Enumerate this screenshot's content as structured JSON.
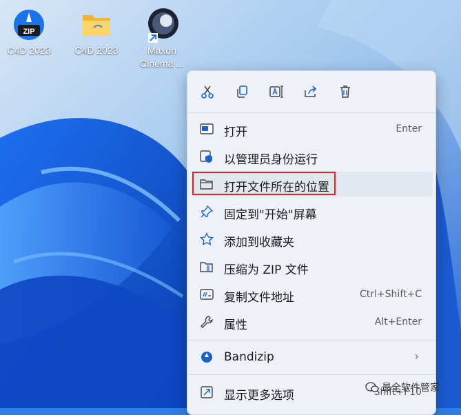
{
  "desktop": {
    "icons": [
      {
        "label": "C4D 2023",
        "icon": "bandizip-zip-icon"
      },
      {
        "label": "C4D 2023",
        "icon": "folder-icon"
      },
      {
        "label": "Maxon Cinema ...",
        "icon": "cinema4d-shortcut-icon"
      }
    ],
    "zip_badge": "ZIP"
  },
  "menu": {
    "toolbar": [
      "cut-icon",
      "copy-icon",
      "rename-icon",
      "share-icon",
      "delete-icon"
    ],
    "items": [
      {
        "label": "打开",
        "shortcut": "Enter",
        "icon": "open-app-icon"
      },
      {
        "label": "以管理员身份运行",
        "shortcut": "",
        "icon": "admin-shield-icon"
      },
      {
        "label": "打开文件所在的位置",
        "shortcut": "",
        "icon": "folder-open-icon",
        "highlighted": true
      },
      {
        "label": "固定到\"开始\"屏幕",
        "shortcut": "",
        "icon": "pin-icon"
      },
      {
        "label": "添加到收藏夹",
        "shortcut": "",
        "icon": "star-icon"
      },
      {
        "label": "压缩为 ZIP 文件",
        "shortcut": "",
        "icon": "zip-folder-icon"
      },
      {
        "label": "复制文件地址",
        "shortcut": "Ctrl+Shift+C",
        "icon": "copy-path-icon"
      },
      {
        "label": "属性",
        "shortcut": "Alt+Enter",
        "icon": "wrench-icon"
      },
      {
        "label": "Bandizip",
        "shortcut": "",
        "icon": "bandizip-icon",
        "submenu": true
      },
      {
        "label": "显示更多选项",
        "shortcut": "Shift+F10",
        "icon": "more-options-icon"
      }
    ]
  },
  "watermark": {
    "text": "最全软件管家"
  },
  "colors": {
    "accent": "#0067c0",
    "highlight_border": "#e0252b"
  }
}
